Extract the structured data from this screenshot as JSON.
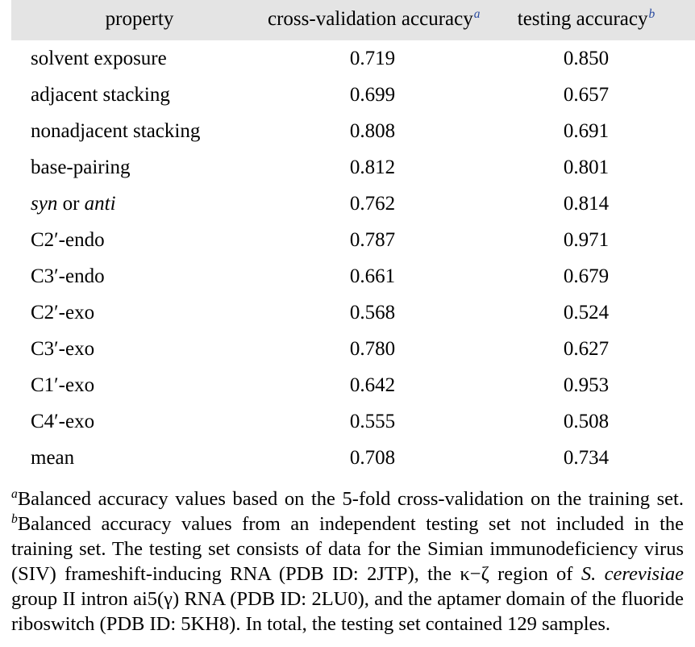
{
  "table": {
    "columns": [
      {
        "label": "property",
        "footnote_mark": ""
      },
      {
        "label": "cross-validation accuracy",
        "footnote_mark": "a"
      },
      {
        "label": "testing accuracy",
        "footnote_mark": "b"
      }
    ],
    "rows": [
      {
        "property": "solvent exposure",
        "cv": "0.719",
        "test": "0.850"
      },
      {
        "property": "adjacent stacking",
        "cv": "0.699",
        "test": "0.657"
      },
      {
        "property": "nonadjacent stacking",
        "cv": "0.808",
        "test": "0.691"
      },
      {
        "property": "base-pairing",
        "cv": "0.812",
        "test": "0.801"
      },
      {
        "property": "syn or anti",
        "cv": "0.762",
        "test": "0.814"
      },
      {
        "property": "C2′-endo",
        "cv": "0.787",
        "test": "0.971"
      },
      {
        "property": "C3′-endo",
        "cv": "0.661",
        "test": "0.679"
      },
      {
        "property": "C2′-exo",
        "cv": "0.568",
        "test": "0.524"
      },
      {
        "property": "C3′-exo",
        "cv": "0.780",
        "test": "0.627"
      },
      {
        "property": "C1′-exo",
        "cv": "0.642",
        "test": "0.953"
      },
      {
        "property": "C4′-exo",
        "cv": "0.555",
        "test": "0.508"
      },
      {
        "property": "mean",
        "cv": "0.708",
        "test": "0.734"
      }
    ],
    "header_background": "#e4e4e4",
    "footnote_mark_color": "#2a4ba0"
  },
  "footnotes": {
    "a_mark": "a",
    "a_text": "Balanced accuracy values based on the 5-fold cross-validation on the training set. ",
    "b_mark": "b",
    "b_text_part1": "Balanced accuracy values from an independent testing set not included in the training set. The testing set consists of data for the Simian immunodeficiency virus (SIV) frameshift-inducing RNA (PDB ID: 2JTP), the κ−ζ region of ",
    "b_species": "S. cerevisiae",
    "b_text_part2": " group II intron ai5(γ) RNA (PDB ID: 2LU0), and the aptamer domain of the fluoride riboswitch (PDB ID: 5KH8). In total, the testing set contained 129 samples."
  }
}
